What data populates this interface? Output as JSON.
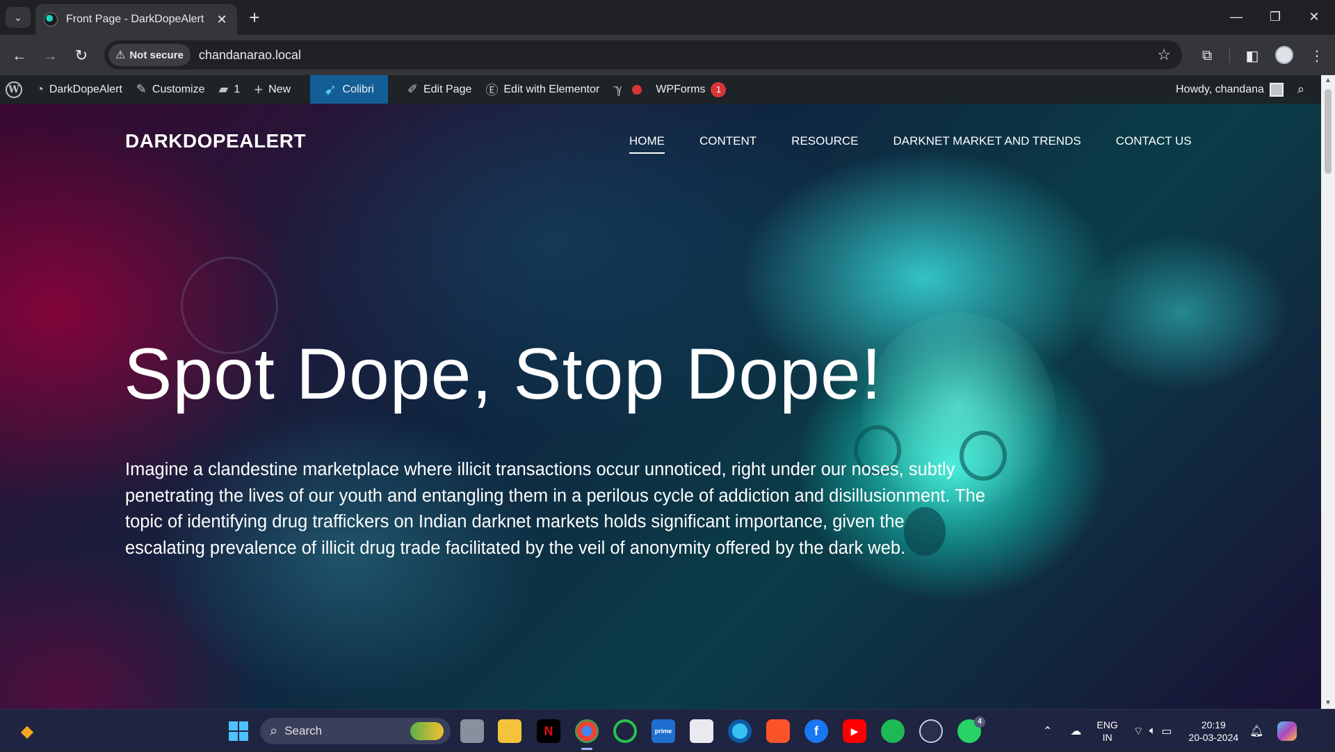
{
  "browser": {
    "tab_title": "Front Page - DarkDopeAlert",
    "security_label": "Not secure",
    "url": "chandanarao.local"
  },
  "adminbar": {
    "site_name": "DarkDopeAlert",
    "customize": "Customize",
    "comments_count": "1",
    "new": "New",
    "colibri": "Colibri",
    "edit_page": "Edit Page",
    "edit_elementor": "Edit with Elementor",
    "wpforms": "WPForms",
    "wpforms_badge": "1",
    "howdy": "Howdy, chandana"
  },
  "site": {
    "title": "DARKDOPEALERT",
    "menu": [
      {
        "label": "HOME",
        "active": true
      },
      {
        "label": "CONTENT",
        "active": false
      },
      {
        "label": "RESOURCE",
        "active": false
      },
      {
        "label": "DARKNET MARKET AND TRENDS",
        "active": false
      },
      {
        "label": "CONTACT US",
        "active": false
      }
    ],
    "hero_title": "Spot Dope, Stop Dope!",
    "hero_text": "Imagine a clandestine marketplace where illicit transactions occur unnoticed, right under our noses, subtly penetrating the lives of our youth and entangling them in a perilous cycle of addiction and disillusionment. The topic of identifying drug traffickers on Indian darknet markets holds significant importance, given the escalating prevalence of illicit drug trade facilitated by the veil of anonymity offered by the dark web."
  },
  "taskbar": {
    "search_label": "Search",
    "lang_top": "ENG",
    "lang_bottom": "IN",
    "time": "20:19",
    "date": "20-03-2024",
    "whatsapp_badge": "4"
  },
  "colors": {
    "adminbar_bg": "#1d2327",
    "colibri_active": "#135e96",
    "badge_red": "#d63638",
    "taskbar_bg": "#1f2440"
  }
}
